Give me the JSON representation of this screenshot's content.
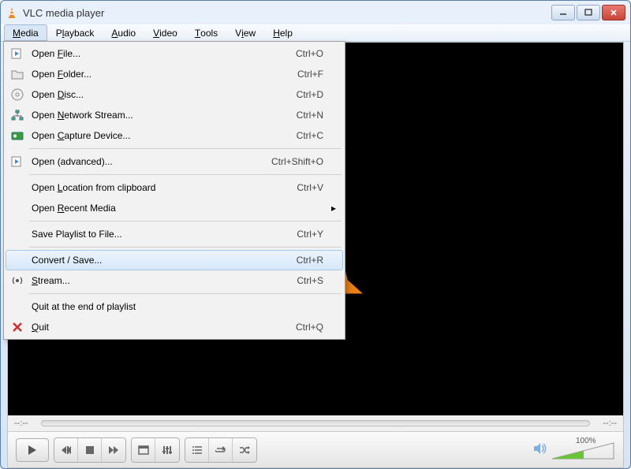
{
  "window": {
    "title": "VLC media player"
  },
  "menubar": {
    "items": [
      {
        "label": "Media",
        "accel": "M",
        "open": true
      },
      {
        "label": "Playback",
        "accel": "l"
      },
      {
        "label": "Audio",
        "accel": "A"
      },
      {
        "label": "Video",
        "accel": "V"
      },
      {
        "label": "Tools",
        "accel": "T"
      },
      {
        "label": "View",
        "accel": "i"
      },
      {
        "label": "Help",
        "accel": "H"
      }
    ]
  },
  "dropdown": [
    {
      "icon": "file-play",
      "label": "Open File...",
      "u": "F",
      "shortcut": "Ctrl+O"
    },
    {
      "icon": "folder",
      "label": "Open Folder...",
      "u": "F",
      "uIdx": 5,
      "shortcut": "Ctrl+F"
    },
    {
      "icon": "disc",
      "label": "Open Disc...",
      "u": "D",
      "shortcut": "Ctrl+D"
    },
    {
      "icon": "network",
      "label": "Open Network Stream...",
      "u": "N",
      "shortcut": "Ctrl+N"
    },
    {
      "icon": "capture",
      "label": "Open Capture Device...",
      "u": "C",
      "shortcut": "Ctrl+C"
    },
    {
      "sep": true
    },
    {
      "icon": "file-play",
      "label": "Open (advanced)...",
      "shortcut": "Ctrl+Shift+O"
    },
    {
      "sep": true
    },
    {
      "label": "Open Location from clipboard",
      "u": "L",
      "shortcut": "Ctrl+V"
    },
    {
      "label": "Open Recent Media",
      "u": "R",
      "submenu": true
    },
    {
      "sep": true
    },
    {
      "label": "Save Playlist to File...",
      "shortcut": "Ctrl+Y"
    },
    {
      "sep": true
    },
    {
      "label": "Convert / Save...",
      "shortcut": "Ctrl+R",
      "highlight": true
    },
    {
      "icon": "stream",
      "label": "Stream...",
      "u": "S",
      "shortcut": "Ctrl+S"
    },
    {
      "sep": true
    },
    {
      "label": "Quit at the end of playlist"
    },
    {
      "icon": "quit",
      "label": "Quit",
      "u": "Q",
      "shortcut": "Ctrl+Q"
    }
  ],
  "transport": {
    "time_left": "--:--",
    "time_right": "--:--"
  },
  "volume": {
    "label": "100%",
    "level": 100
  }
}
